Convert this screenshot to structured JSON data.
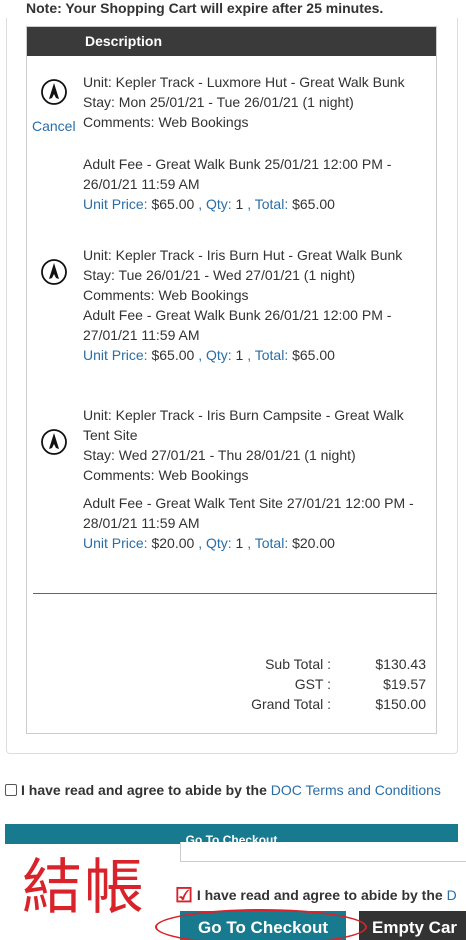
{
  "note": "Note: Your Shopping Cart will expire after 25 minutes.",
  "table": {
    "header": "Description",
    "cancel_label": "Cancel",
    "items": [
      {
        "unit": "Unit: Kepler Track - Luxmore Hut - Great Walk Bunk",
        "stay": "Stay: Mon 25/01/21 - Tue 26/01/21 (1 night)",
        "comments": "Comments: Web Bookings",
        "fee": "Adult Fee - Great Walk Bunk 25/01/21 12:00 PM - 26/01/21 11:59 AM",
        "unit_price_label": "Unit Price:",
        "unit_price": "$65.00",
        "qty_label": "Qty:",
        "qty": "1",
        "total_label": "Total:",
        "total": "$65.00"
      },
      {
        "unit": "Unit: Kepler Track - Iris Burn Hut - Great Walk Bunk",
        "stay": "Stay: Tue 26/01/21 - Wed 27/01/21 (1 night)",
        "comments": "Comments: Web Bookings",
        "fee": "Adult Fee - Great Walk Bunk 26/01/21 12:00 PM - 27/01/21 11:59 AM",
        "unit_price_label": "Unit Price:",
        "unit_price": "$65.00",
        "qty_label": "Qty:",
        "qty": "1",
        "total_label": "Total:",
        "total": "$65.00"
      },
      {
        "unit": "Unit: Kepler Track - Iris Burn Campsite - Great Walk Tent Site",
        "stay": "Stay: Wed 27/01/21 - Thu 28/01/21 (1 night)",
        "comments": "Comments: Web Bookings",
        "fee": "Adult Fee - Great Walk Tent Site 27/01/21 12:00 PM - 28/01/21 11:59 AM",
        "unit_price_label": "Unit Price:",
        "unit_price": "$20.00",
        "qty_label": "Qty:",
        "qty": "1",
        "total_label": "Total:",
        "total": "$20.00"
      }
    ],
    "totals": {
      "subtotal_label": "Sub Total :",
      "subtotal": "$130.43",
      "gst_label": "GST :",
      "gst": "$19.57",
      "grand_label": "Grand Total :",
      "grand": "$150.00"
    }
  },
  "agree": {
    "text": "I have read and agree to abide by the",
    "link": "DOC Terms and Conditions"
  },
  "checkout_bar_label": "Go To Checkout",
  "annotation": {
    "cjk_label": "結帳",
    "agree_text": "I have read and agree to abide by the",
    "agree_link_fragment": "D",
    "checkout_label": "Go To Checkout",
    "empty_label": "Empty Car"
  },
  "icons": {
    "item_icon": "hiker-icon",
    "annotation_check": "red-checkmark-icon"
  },
  "colors": {
    "header_bg": "#3a3a3a",
    "link": "#2a6ea6",
    "primary_button": "#177a8f",
    "dark_button": "#333333",
    "annotation_red": "#d8232a"
  }
}
